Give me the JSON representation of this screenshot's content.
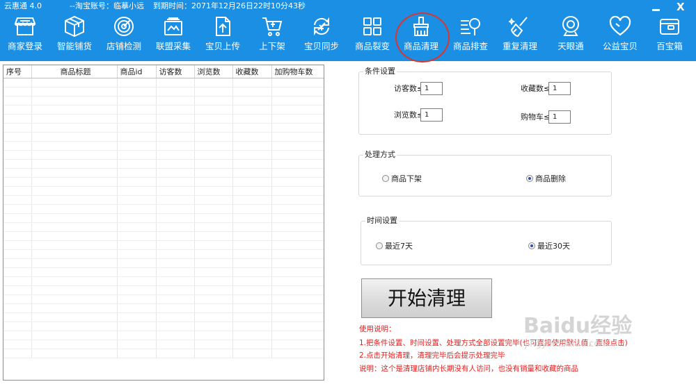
{
  "titlebar": {
    "app_name": "云惠通  4.0",
    "account": "--淘宝账号：临摹小远",
    "expiry": "到期时间：2071年12月26日22时10分43秒",
    "close": "X"
  },
  "toolbar": {
    "items": [
      {
        "label": "商家登录",
        "icon": "shop-icon"
      },
      {
        "label": "智能铺货",
        "icon": "box-icon"
      },
      {
        "label": "店铺检测",
        "icon": "radar-icon"
      },
      {
        "label": "联盟采集",
        "icon": "collect-icon"
      },
      {
        "label": "宝贝上传",
        "icon": "upload-icon"
      },
      {
        "label": "上下架",
        "icon": "cart-icon"
      },
      {
        "label": "宝贝同步",
        "icon": "sync-icon"
      },
      {
        "label": "商品裂变",
        "icon": "grid-icon"
      },
      {
        "label": "商品清理",
        "icon": "broom-icon"
      },
      {
        "label": "商品排查",
        "icon": "search-icon"
      },
      {
        "label": "重复清理",
        "icon": "sweep-icon"
      },
      {
        "label": "天眼通",
        "icon": "camera-icon"
      },
      {
        "label": "公益宝贝",
        "icon": "heart-icon"
      },
      {
        "label": "百宝箱",
        "icon": "wallet-icon"
      }
    ]
  },
  "table": {
    "columns": [
      "序号",
      "商品标题",
      "商品id",
      "访客数",
      "浏览数",
      "收藏数",
      "加购物车数"
    ],
    "rows": []
  },
  "conditions": {
    "title": "条件设置",
    "visitors_label": "访客数≤",
    "visitors_value": "1",
    "favorites_label": "收藏数≤",
    "favorites_value": "1",
    "views_label": "浏览数≤",
    "views_value": "1",
    "cart_label": "购物车≤",
    "cart_value": "1"
  },
  "processing": {
    "title": "处理方式",
    "option_offshelf": "商品下架",
    "option_delete": "商品删除",
    "selected": "商品删除"
  },
  "time": {
    "title": "时间设置",
    "option_7": "最近7天",
    "option_30": "最近30天",
    "selected": "最近30天"
  },
  "start_button": "开始清理",
  "notes": {
    "heading": "使用说明：",
    "step1": "1.把条件设置、时间设置、处理方式全部设置完毕(也可直接使用默认值，直接点击)",
    "step2": "2.点击开始清理，清理完毕后会提示处理完毕",
    "remark": "说明：这个是清理店铺内长期没有人访问，也没有销量和收藏的商品"
  },
  "watermark": {
    "brand": "Baidu经验",
    "url": "jingyan.baidu.com"
  },
  "colors": {
    "header_bg": "#1a8fe3",
    "highlight_circle": "#d9362e",
    "note_text": "#e02020"
  }
}
